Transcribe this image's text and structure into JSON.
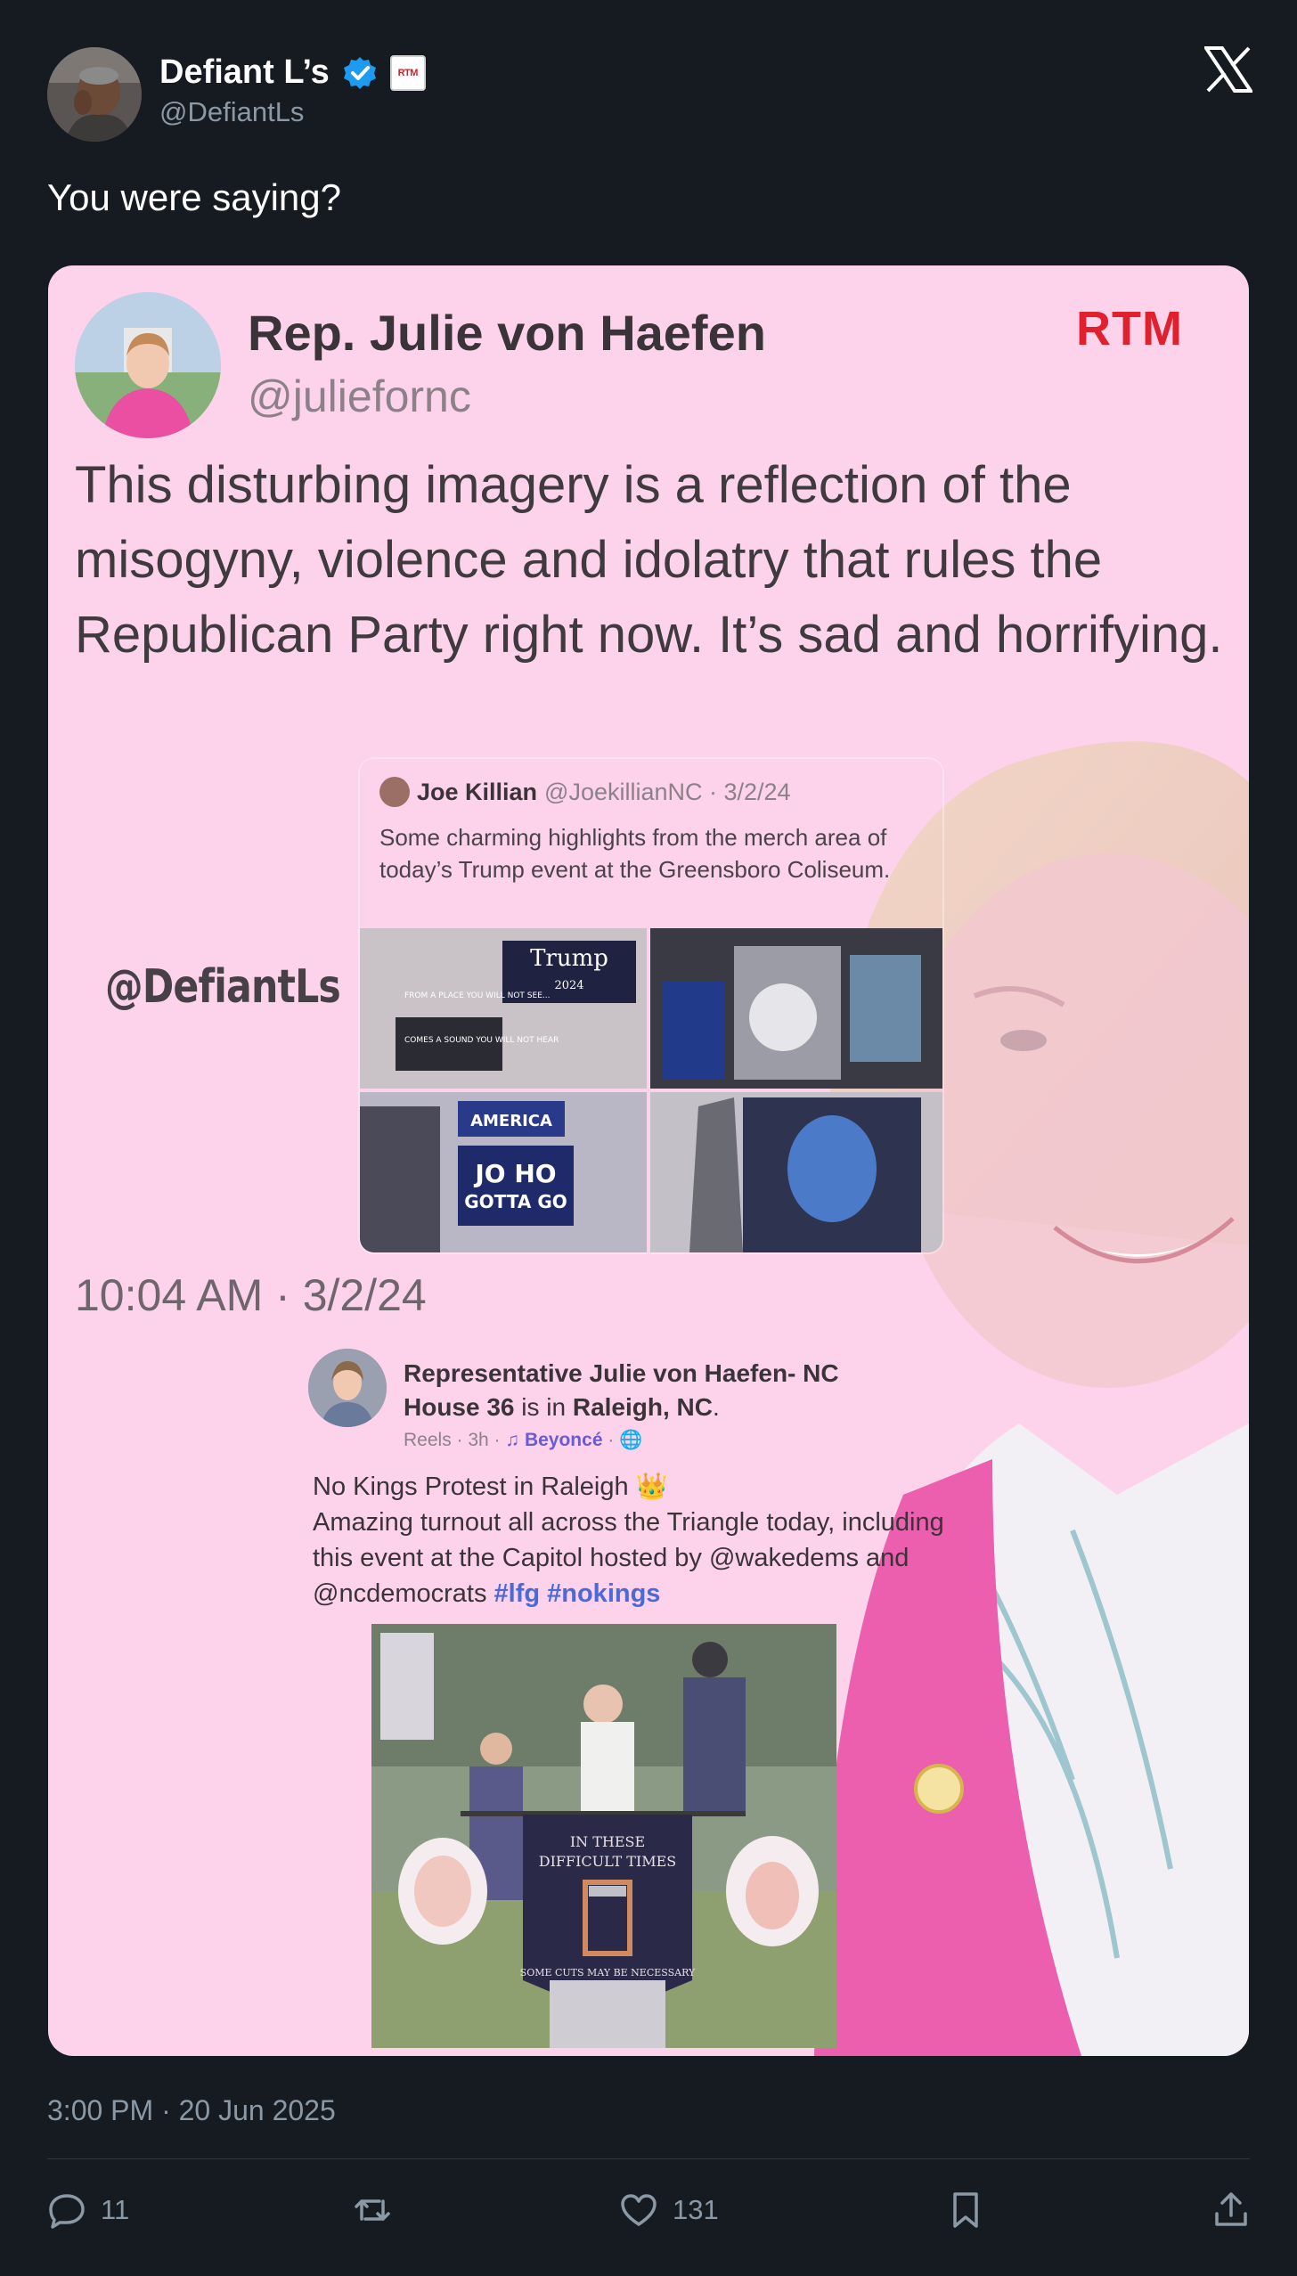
{
  "tweet": {
    "author_name": "Defiant L’s",
    "author_handle": "@DefiantLs",
    "text": "You were saying?",
    "timestamp": "3:00 PM · 20 Jun 2025",
    "badge_text": "RTM"
  },
  "image": {
    "julie_name": "Rep. Julie von Haefen",
    "julie_handle": "@julieforнc",
    "rtm_logo": "RTM",
    "julie_text": "This disturbing imagery is a reflection of the misogyny, violence and idolatry that rules the Republican Party right now. It’s sad and horrifying.",
    "watermark": "@DefiantLs",
    "quote": {
      "name": "Joe Killian",
      "meta": "@JoekillianNC · 3/2/24",
      "text": "Some charming highlights from the merch area of today’s Trump event at the Greensboro Coliseum.",
      "signs": {
        "trump": "Trump",
        "year": "2024",
        "place": "FROM A PLACE YOU WILL NOT SEE...",
        "sound": "COMES A SOUND YOU WILL NOT HEAR",
        "america": "AMERICA",
        "joho": "JO HO",
        "gotta": "GOTTA GO"
      }
    },
    "timestamp": "10:04 AM · 3/2/24",
    "fb": {
      "name_part1": "Representative Julie von Haefen- NC House 36",
      "name_is": " is in ",
      "name_place": "Raleigh, NC",
      "name_end": ".",
      "meta_reels": "Reels · 3h · ",
      "meta_song": "♫ Beyoncé",
      "meta_end": " · ",
      "line1": "No Kings Protest in Raleigh 👑",
      "line2": "Amazing turnout all across the Triangle today, including this event at the Capitol hosted by @wakedems and @ncdemocrats ",
      "tags": "#lfg #nokings",
      "banner_line1": "IN THESE",
      "banner_line2": "DIFFICULT TIMES",
      "banner_line3": "SOME CUTS MAY BE NECESSARY"
    }
  },
  "actions": {
    "replies": "11",
    "retweets": "",
    "likes": "131"
  },
  "colors": {
    "background": "#161b22",
    "pink_overlay": "#fdd3ec",
    "accent_blue": "#1d9bf0",
    "rtm_red": "#e0202d"
  }
}
